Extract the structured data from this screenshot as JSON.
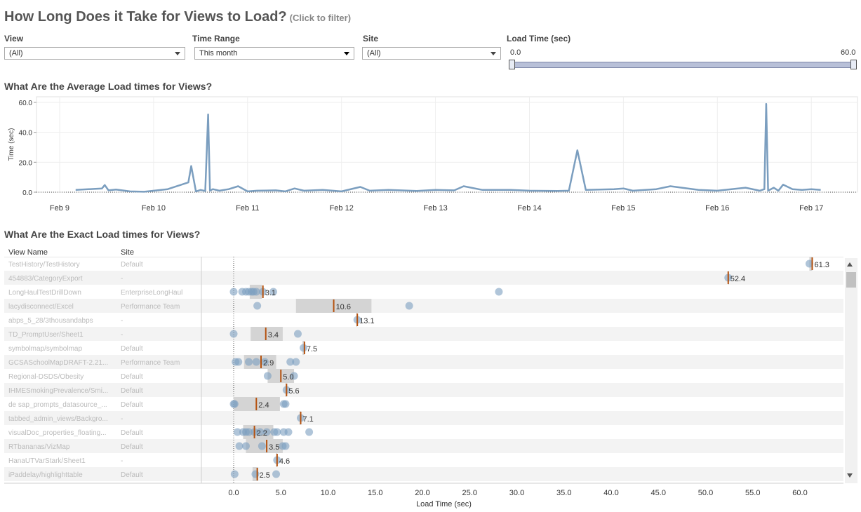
{
  "header": {
    "title": "How Long Does it Take for Views to Load?",
    "subtitle": "(Click to filter)"
  },
  "filters": {
    "view": {
      "label": "View",
      "value": "(All)"
    },
    "time_range": {
      "label": "Time Range",
      "value": "This month"
    },
    "site": {
      "label": "Site",
      "value": "(All)"
    },
    "load_time": {
      "label": "Load Time (sec)",
      "min": "0.0",
      "max": "60.0",
      "range_min": 0,
      "range_max": 60
    }
  },
  "colors": {
    "line": "#7b9ebf",
    "dot": "#7b9ebf",
    "band": "#d4d4d4",
    "median": "#b5520f",
    "grid": "#eeeeee"
  },
  "chart_data": [
    {
      "type": "line",
      "title": "What Are the Average Load times for Views?",
      "ylabel": "Time (sec)",
      "xlabel": "",
      "ylim": [
        0,
        60
      ],
      "yticks": [
        "0.0",
        "20.0",
        "40.0",
        "60.0"
      ],
      "xticks": [
        "Feb 9",
        "Feb 10",
        "Feb 11",
        "Feb 12",
        "Feb 13",
        "Feb 14",
        "Feb 15",
        "Feb 16",
        "Feb 17"
      ],
      "grid": true,
      "x": [
        9.17,
        9.45,
        9.48,
        9.52,
        9.6,
        9.75,
        9.9,
        10.15,
        10.37,
        10.4,
        10.45,
        10.5,
        10.55,
        10.58,
        10.6,
        10.63,
        10.7,
        10.8,
        10.9,
        11.0,
        11.1,
        11.3,
        11.4,
        11.5,
        11.6,
        11.8,
        12.0,
        12.2,
        12.3,
        12.5,
        12.8,
        13.0,
        13.2,
        13.3,
        13.5,
        13.8,
        14.0,
        14.3,
        14.42,
        14.51,
        14.6,
        14.9,
        15.0,
        15.1,
        15.35,
        15.5,
        15.8,
        16.0,
        16.3,
        16.45,
        16.5,
        16.52,
        16.54,
        16.6,
        16.65,
        16.7,
        16.8,
        16.9,
        17.0,
        17.1
      ],
      "y": [
        1.5,
        2.5,
        4.8,
        1.2,
        1.8,
        0.5,
        0.3,
        2.0,
        6.5,
        17.5,
        0.5,
        1.5,
        0.8,
        52.0,
        1.0,
        2.0,
        1.0,
        2.0,
        4.0,
        0.5,
        1.0,
        1.2,
        0.5,
        2.5,
        1.0,
        1.5,
        0.5,
        3.5,
        1.0,
        1.5,
        0.8,
        1.5,
        1.2,
        4.0,
        1.5,
        1.5,
        1.0,
        0.8,
        1.0,
        28.0,
        1.5,
        2.0,
        2.5,
        1.0,
        2.0,
        4.0,
        1.5,
        1.0,
        3.0,
        1.0,
        2.0,
        59.0,
        1.0,
        3.0,
        1.0,
        5.0,
        2.0,
        1.5,
        2.0,
        1.5
      ]
    },
    {
      "type": "scatter",
      "title": "What Are the Exact Load times for Views?",
      "xlabel": "Load Time (sec)",
      "ylabel": "",
      "xlim": [
        0,
        65
      ],
      "xticks": [
        "0.0",
        "5.0",
        "10.0",
        "15.0",
        "20.0",
        "25.0",
        "30.0",
        "35.0",
        "40.0",
        "45.0",
        "50.0",
        "55.0",
        "60.0"
      ],
      "columns": [
        "View Name",
        "Site"
      ],
      "rows": [
        {
          "name": "TestHistory/TestHistory",
          "site": "Default",
          "points": [
            61.0
          ],
          "band": [
            61.0,
            61.3
          ],
          "median": 61.3,
          "label": "61.3"
        },
        {
          "name": "454883/CategoryExport",
          "site": "-",
          "points": [
            52.4
          ],
          "band": [
            52.4,
            52.4
          ],
          "median": 52.4,
          "label": "52.4"
        },
        {
          "name": "LongHaulTestDrillDown",
          "site": "EnterpriseLongHaul",
          "points": [
            0.0,
            0.9,
            1.3,
            1.6,
            1.9,
            2.1,
            2.4,
            3.1,
            4.2,
            28.1
          ],
          "band": [
            1.7,
            3.0
          ],
          "median": 3.1,
          "label": "3.1"
        },
        {
          "name": "lacydisconnect/Excel",
          "site": "Performance Team",
          "points": [
            2.5,
            18.6
          ],
          "band": [
            6.6,
            14.6
          ],
          "median": 10.6,
          "label": "10.6"
        },
        {
          "name": "abps_5_28/3thousandabps",
          "site": "-",
          "points": [
            13.1
          ],
          "band": [
            13.0,
            13.1
          ],
          "median": 13.1,
          "label": "13.1"
        },
        {
          "name": "TD_PromptUser/Sheet1",
          "site": "-",
          "points": [
            0.0,
            6.8
          ],
          "band": [
            1.8,
            5.2
          ],
          "median": 3.4,
          "label": "3.4"
        },
        {
          "name": "symbolmap/symbolmap",
          "site": "Default",
          "points": [
            7.4
          ],
          "band": [
            7.3,
            7.5
          ],
          "median": 7.5,
          "label": "7.5"
        },
        {
          "name": "GCSASchoolMapDRAFT-2.21...",
          "site": "Performance Team",
          "points": [
            0.2,
            0.5,
            1.6,
            2.4,
            3.3,
            6.0,
            6.6
          ],
          "band": [
            1.1,
            4.5
          ],
          "median": 2.9,
          "label": "2.9"
        },
        {
          "name": "Regional-DSDS/Obesity",
          "site": "Default",
          "points": [
            3.6,
            6.4
          ],
          "band": [
            3.6,
            6.4
          ],
          "median": 5.0,
          "label": "5.0"
        },
        {
          "name": "IHMESmokingPrevalence/Smi...",
          "site": "Default",
          "points": [
            5.6
          ],
          "band": [
            5.5,
            5.6
          ],
          "median": 5.6,
          "label": "5.6"
        },
        {
          "name": "de sap_prompts_datasource_...",
          "site": "Default",
          "points": [
            0.0,
            0.1,
            5.3,
            5.5
          ],
          "band": [
            0.0,
            4.9
          ],
          "median": 2.4,
          "label": "2.4"
        },
        {
          "name": "tabbed_admin_views/Backgro...",
          "site": "-",
          "points": [
            7.1
          ],
          "band": [
            7.0,
            7.1
          ],
          "median": 7.1,
          "label": "7.1"
        },
        {
          "name": "visualDoc_properties_floating...",
          "site": "Default",
          "points": [
            0.4,
            1.0,
            1.3,
            1.6,
            2.2,
            2.8,
            3.5,
            4.3,
            4.6,
            5.3,
            5.8,
            8.0
          ],
          "band": [
            1.0,
            4.2
          ],
          "median": 2.2,
          "label": "2.2"
        },
        {
          "name": "RTbananas/VizMap",
          "site": "Default",
          "points": [
            0.6,
            1.3,
            3.0,
            5.2,
            5.5
          ],
          "band": [
            1.3,
            5.2
          ],
          "median": 3.5,
          "label": "3.5"
        },
        {
          "name": "HanaUTVarStark/Sheet1",
          "site": "-",
          "points": [
            4.6
          ],
          "band": [
            4.5,
            4.6
          ],
          "median": 4.6,
          "label": "4.6"
        },
        {
          "name": "iPaddelay/highlighttable",
          "site": "Default",
          "points": [
            0.1,
            2.3,
            4.5
          ],
          "band": [
            2.0,
            2.6
          ],
          "median": 2.5,
          "label": "2.5"
        }
      ]
    }
  ]
}
